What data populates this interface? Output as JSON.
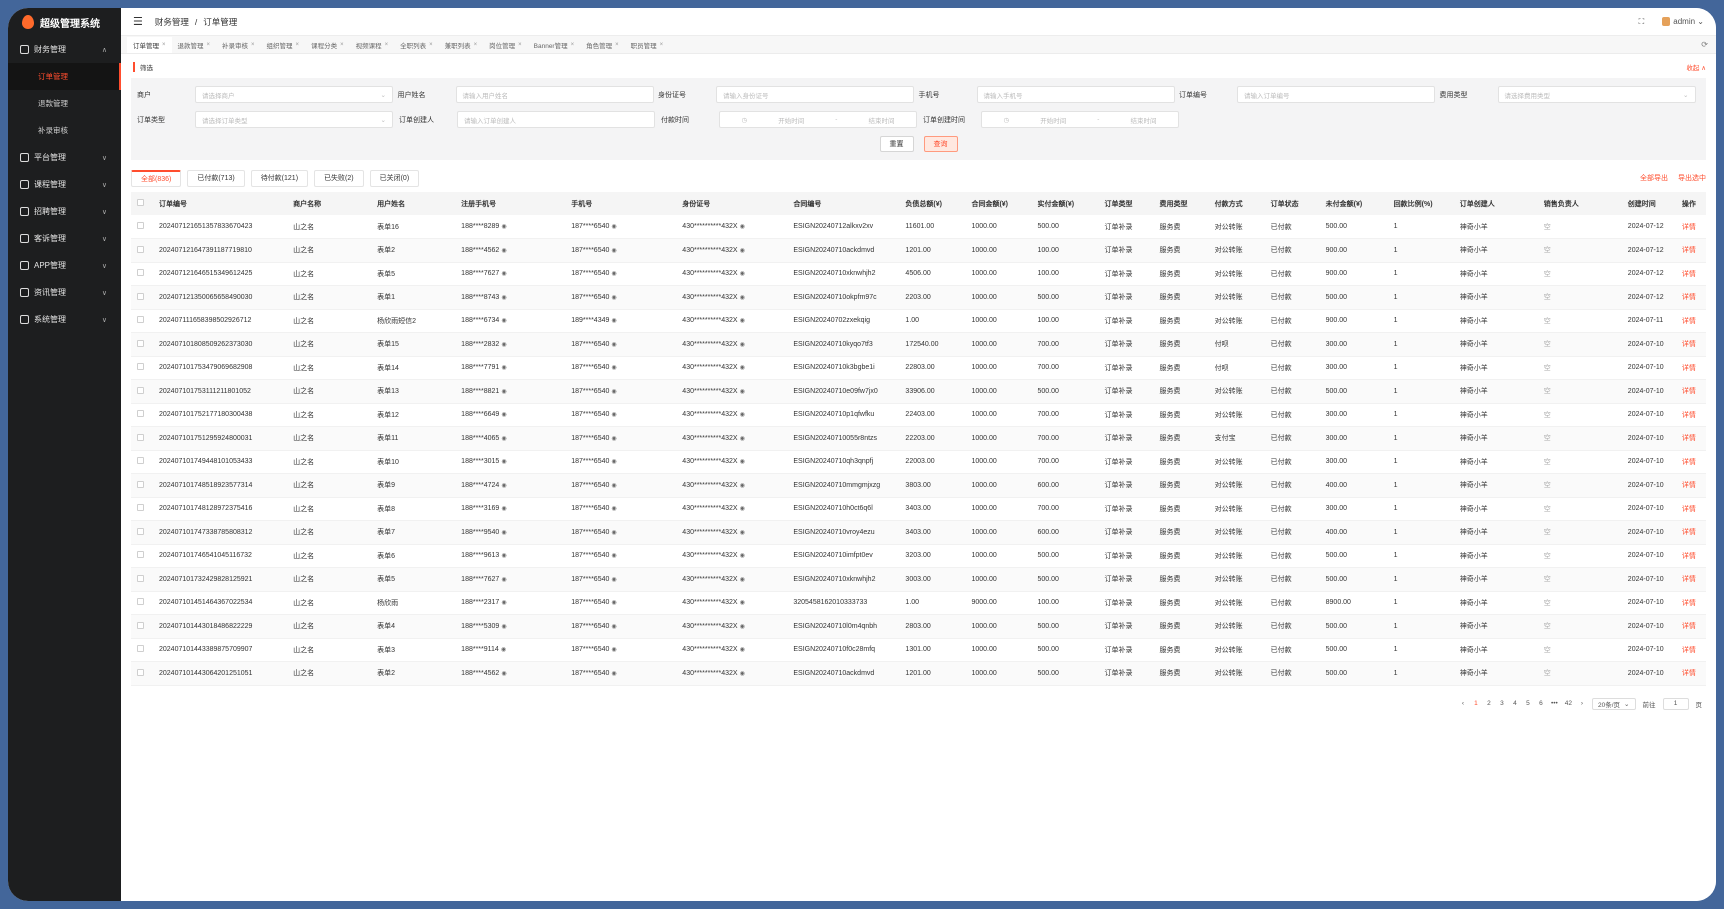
{
  "app": {
    "title": "超级管理系统"
  },
  "sidebar": {
    "items": [
      {
        "label": "财务管理",
        "icon": "wallet-icon",
        "chev": "∧",
        "open": true,
        "children": [
          {
            "label": "订单管理",
            "active": true
          },
          {
            "label": "退款管理"
          },
          {
            "label": "补录审核"
          }
        ]
      },
      {
        "label": "平台管理",
        "icon": "user-icon",
        "chev": "∨"
      },
      {
        "label": "课程管理",
        "icon": "book-icon",
        "chev": "∨"
      },
      {
        "label": "招聘管理",
        "icon": "person-icon",
        "chev": "∨"
      },
      {
        "label": "客诉管理",
        "icon": "info-icon",
        "chev": "∨"
      },
      {
        "label": "APP管理",
        "icon": "phone-icon",
        "chev": "∨"
      },
      {
        "label": "资讯管理",
        "icon": "news-icon",
        "chev": "∨"
      },
      {
        "label": "系统管理",
        "icon": "gear-icon",
        "chev": "∨"
      }
    ]
  },
  "header": {
    "breadcrumb": [
      "财务管理",
      "/",
      "订单管理"
    ],
    "user": "admin",
    "fullscreen": "⛶"
  },
  "tabs": [
    {
      "label": "订单管理",
      "active": true
    },
    {
      "label": "退款管理"
    },
    {
      "label": "补录审核"
    },
    {
      "label": "组织管理"
    },
    {
      "label": "课程分类"
    },
    {
      "label": "视频课程"
    },
    {
      "label": "全职列表"
    },
    {
      "label": "兼职列表"
    },
    {
      "label": "岗位管理"
    },
    {
      "label": "Banner管理"
    },
    {
      "label": "角色管理"
    },
    {
      "label": "职员管理"
    }
  ],
  "filter": {
    "title": "筛选",
    "collapse": "收起 ∧",
    "row1": [
      {
        "label": "商户",
        "placeholder": "请选择商户",
        "type": "select"
      },
      {
        "label": "用户姓名",
        "placeholder": "请输入用户姓名"
      },
      {
        "label": "身份证号",
        "placeholder": "请输入身份证号"
      },
      {
        "label": "手机号",
        "placeholder": "请输入手机号"
      },
      {
        "label": "订单编号",
        "placeholder": "请输入订单编号"
      },
      {
        "label": "费用类型",
        "placeholder": "请选择费用类型",
        "type": "select"
      }
    ],
    "row2": [
      {
        "label": "订单类型",
        "placeholder": "请选择订单类型",
        "type": "select"
      },
      {
        "label": "订单创建人",
        "placeholder": "请输入订单创建人"
      },
      {
        "label": "付款时间",
        "start": "开始时间",
        "sep": "-",
        "end": "结束时间",
        "type": "date"
      },
      {
        "label": "订单创建时间",
        "start": "开始时间",
        "sep": "-",
        "end": "结束时间",
        "type": "date"
      }
    ],
    "reset": "重置",
    "search": "查询"
  },
  "status_tabs": [
    {
      "label": "全部(836)",
      "active": true
    },
    {
      "label": "已付款(713)"
    },
    {
      "label": "待付款(121)"
    },
    {
      "label": "已失败(2)"
    },
    {
      "label": "已关闭(0)"
    }
  ],
  "export": {
    "all": "全部导出",
    "selected": "导出选中"
  },
  "table": {
    "columns": [
      "订单编号",
      "商户名称",
      "用户姓名",
      "注册手机号",
      "手机号",
      "身份证号",
      "合同编号",
      "负债总额(¥)",
      "合同金额(¥)",
      "实付金额(¥)",
      "订单类型",
      "费用类型",
      "付款方式",
      "订单状态",
      "未付金额(¥)",
      "回款比例(%)",
      "订单创建人",
      "销售负责人",
      "创建时间",
      "操作"
    ],
    "rows": [
      [
        "202407121651357833670423",
        "山之名",
        "表单16",
        "188****8289",
        "187****6540",
        "430**********432X",
        "ESIGN20240712alkxv2xv",
        "11601.00",
        "1000.00",
        "500.00",
        "订单补录",
        "服务费",
        "对公转账",
        "已付款",
        "500.00",
        "1",
        "神奇小羊",
        "空",
        "2024-07-12",
        "详情"
      ],
      [
        "202407121647391187719810",
        "山之名",
        "表单2",
        "188****4562",
        "187****6540",
        "430**********432X",
        "ESIGN20240710ackdmvd",
        "1201.00",
        "1000.00",
        "100.00",
        "订单补录",
        "服务费",
        "对公转账",
        "已付款",
        "900.00",
        "1",
        "神奇小羊",
        "空",
        "2024-07-12",
        "详情"
      ],
      [
        "202407121646515349612425",
        "山之名",
        "表单5",
        "188****7627",
        "187****6540",
        "430**********432X",
        "ESIGN20240710xknwhjh2",
        "4506.00",
        "1000.00",
        "100.00",
        "订单补录",
        "服务费",
        "对公转账",
        "已付款",
        "900.00",
        "1",
        "神奇小羊",
        "空",
        "2024-07-12",
        "详情"
      ],
      [
        "202407121350065658490030",
        "山之名",
        "表单1",
        "188****8743",
        "187****6540",
        "430**********432X",
        "ESIGN20240710okpfm97c",
        "2203.00",
        "1000.00",
        "500.00",
        "订单补录",
        "服务费",
        "对公转账",
        "已付款",
        "500.00",
        "1",
        "神奇小羊",
        "空",
        "2024-07-12",
        "详情"
      ],
      [
        "202407111658398502926712",
        "山之名",
        "杨欣雨短信2",
        "188****6734",
        "189****4349",
        "430**********432X",
        "ESIGN20240702zxekqig",
        "1.00",
        "1000.00",
        "100.00",
        "订单补录",
        "服务费",
        "对公转账",
        "已付款",
        "900.00",
        "1",
        "神奇小羊",
        "空",
        "2024-07-11",
        "详情"
      ],
      [
        "202407101808509262373030",
        "山之名",
        "表单15",
        "188****2832",
        "187****6540",
        "430**********432X",
        "ESIGN20240710kyqo7tf3",
        "172540.00",
        "1000.00",
        "700.00",
        "订单补录",
        "服务费",
        "付呗",
        "已付款",
        "300.00",
        "1",
        "神奇小羊",
        "空",
        "2024-07-10",
        "详情"
      ],
      [
        "202407101753479069682908",
        "山之名",
        "表单14",
        "188****7791",
        "187****6540",
        "430**********432X",
        "ESIGN20240710k3bgbe1i",
        "22803.00",
        "1000.00",
        "700.00",
        "订单补录",
        "服务费",
        "付呗",
        "已付款",
        "300.00",
        "1",
        "神奇小羊",
        "空",
        "2024-07-10",
        "详情"
      ],
      [
        "202407101753111211801052",
        "山之名",
        "表单13",
        "188****8821",
        "187****6540",
        "430**********432X",
        "ESIGN20240710e09fw7jx0",
        "33906.00",
        "1000.00",
        "500.00",
        "订单补录",
        "服务费",
        "对公转账",
        "已付款",
        "500.00",
        "1",
        "神奇小羊",
        "空",
        "2024-07-10",
        "详情"
      ],
      [
        "202407101752177180300438",
        "山之名",
        "表单12",
        "188****6649",
        "187****6540",
        "430**********432X",
        "ESIGN20240710p1qfwfku",
        "22403.00",
        "1000.00",
        "700.00",
        "订单补录",
        "服务费",
        "对公转账",
        "已付款",
        "300.00",
        "1",
        "神奇小羊",
        "空",
        "2024-07-10",
        "详情"
      ],
      [
        "202407101751295924800031",
        "山之名",
        "表单11",
        "188****4065",
        "187****6540",
        "430**********432X",
        "ESIGN20240710055r8ntzs",
        "22203.00",
        "1000.00",
        "700.00",
        "订单补录",
        "服务费",
        "支付宝",
        "已付款",
        "300.00",
        "1",
        "神奇小羊",
        "空",
        "2024-07-10",
        "详情"
      ],
      [
        "202407101749448101053433",
        "山之名",
        "表单10",
        "188****3015",
        "187****6540",
        "430**********432X",
        "ESIGN20240710qh3qnpfj",
        "22003.00",
        "1000.00",
        "700.00",
        "订单补录",
        "服务费",
        "对公转账",
        "已付款",
        "300.00",
        "1",
        "神奇小羊",
        "空",
        "2024-07-10",
        "详情"
      ],
      [
        "202407101748518923577314",
        "山之名",
        "表单9",
        "188****4724",
        "187****6540",
        "430**********432X",
        "ESIGN20240710mmgmjxzg",
        "3803.00",
        "1000.00",
        "600.00",
        "订单补录",
        "服务费",
        "对公转账",
        "已付款",
        "400.00",
        "1",
        "神奇小羊",
        "空",
        "2024-07-10",
        "详情"
      ],
      [
        "202407101748128972375416",
        "山之名",
        "表单8",
        "188****3169",
        "187****6540",
        "430**********432X",
        "ESIGN20240710h0ct6q6l",
        "3403.00",
        "1000.00",
        "700.00",
        "订单补录",
        "服务费",
        "对公转账",
        "已付款",
        "300.00",
        "1",
        "神奇小羊",
        "空",
        "2024-07-10",
        "详情"
      ],
      [
        "202407101747338785808312",
        "山之名",
        "表单7",
        "188****9540",
        "187****6540",
        "430**********432X",
        "ESIGN20240710vroy4ezu",
        "3403.00",
        "1000.00",
        "600.00",
        "订单补录",
        "服务费",
        "对公转账",
        "已付款",
        "400.00",
        "1",
        "神奇小羊",
        "空",
        "2024-07-10",
        "详情"
      ],
      [
        "202407101746541045116732",
        "山之名",
        "表单6",
        "188****9613",
        "187****6540",
        "430**********432X",
        "ESIGN20240710imfpt0ev",
        "3203.00",
        "1000.00",
        "500.00",
        "订单补录",
        "服务费",
        "对公转账",
        "已付款",
        "500.00",
        "1",
        "神奇小羊",
        "空",
        "2024-07-10",
        "详情"
      ],
      [
        "202407101732429828125921",
        "山之名",
        "表单5",
        "188****7627",
        "187****6540",
        "430**********432X",
        "ESIGN20240710xknwhjh2",
        "3003.00",
        "1000.00",
        "500.00",
        "订单补录",
        "服务费",
        "对公转账",
        "已付款",
        "500.00",
        "1",
        "神奇小羊",
        "空",
        "2024-07-10",
        "详情"
      ],
      [
        "202407101451464367022534",
        "山之名",
        "杨欣雨",
        "188****2317",
        "187****6540",
        "430**********432X",
        "3205458162010333733",
        "1.00",
        "9000.00",
        "100.00",
        "订单补录",
        "服务费",
        "对公转账",
        "已付款",
        "8900.00",
        "1",
        "神奇小羊",
        "空",
        "2024-07-10",
        "详情"
      ],
      [
        "202407101443018486822229",
        "山之名",
        "表单4",
        "188****5309",
        "187****6540",
        "430**********432X",
        "ESIGN20240710l0m4qnbh",
        "2803.00",
        "1000.00",
        "500.00",
        "订单补录",
        "服务费",
        "对公转账",
        "已付款",
        "500.00",
        "1",
        "神奇小羊",
        "空",
        "2024-07-10",
        "详情"
      ],
      [
        "202407101443389875709907",
        "山之名",
        "表单3",
        "188****9114",
        "187****6540",
        "430**********432X",
        "ESIGN20240710f0c28mfq",
        "1301.00",
        "1000.00",
        "500.00",
        "订单补录",
        "服务费",
        "对公转账",
        "已付款",
        "500.00",
        "1",
        "神奇小羊",
        "空",
        "2024-07-10",
        "详情"
      ],
      [
        "202407101443064201251051",
        "山之名",
        "表单2",
        "188****4562",
        "187****6540",
        "430**********432X",
        "ESIGN20240710ackdmvd",
        "1201.00",
        "1000.00",
        "500.00",
        "订单补录",
        "服务费",
        "对公转账",
        "已付款",
        "500.00",
        "1",
        "神奇小羊",
        "空",
        "2024-07-10",
        "详情"
      ]
    ]
  },
  "pagination": {
    "prev": "‹",
    "pages": [
      "1",
      "2",
      "3",
      "4",
      "5",
      "6",
      "•••",
      "42"
    ],
    "active": "1",
    "next": "›",
    "page_size": "20条/页",
    "goto_label": "前往",
    "goto_value": "1",
    "goto_suffix": "页"
  }
}
